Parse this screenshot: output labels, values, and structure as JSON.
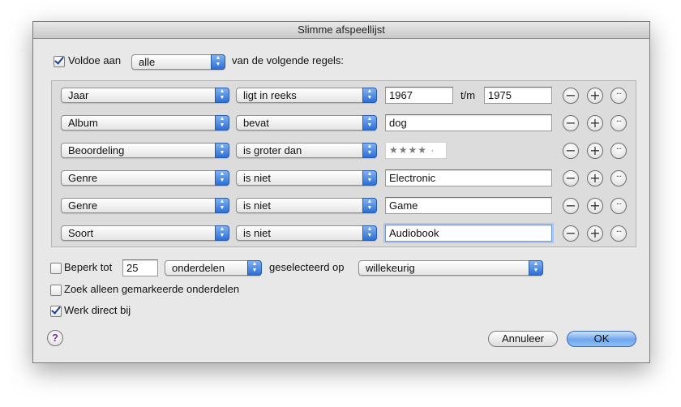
{
  "window": {
    "title": "Slimme afspeellijst"
  },
  "match": {
    "checked": true,
    "prefix": "Voldoe aan",
    "selector": "alle",
    "suffix": "van de volgende regels:"
  },
  "rules": [
    {
      "field": "Jaar",
      "operator": "ligt in reeks",
      "value": "1967",
      "range_label": "t/m",
      "value2": "1975"
    },
    {
      "field": "Album",
      "operator": "bevat",
      "value": "dog"
    },
    {
      "field": "Beoordeling",
      "operator": "is groter dan",
      "stars": "★★★★ ·"
    },
    {
      "field": "Genre",
      "operator": "is niet",
      "value": "Electronic"
    },
    {
      "field": "Genre",
      "operator": "is niet",
      "value": "Game"
    },
    {
      "field": "Soort",
      "operator": "is niet",
      "value": "Audiobook"
    }
  ],
  "row_buttons": {
    "remove": "−",
    "add": "+",
    "more": "···"
  },
  "limit": {
    "label": "Beperk tot",
    "amount": "25",
    "unit": "onderdelen",
    "selected_by_label": "geselecteerd op",
    "selected_by": "willekeurig"
  },
  "only_checked": {
    "label": "Zoek alleen gemarkeerde onderdelen"
  },
  "live_update": {
    "label": "Werk direct bij"
  },
  "buttons": {
    "help": "?",
    "cancel": "Annuleer",
    "ok": "OK"
  },
  "colors": {
    "accent": "#2d6fd6",
    "window_bg": "#e8e8e8",
    "rules_bg": "#dcdcdc"
  }
}
